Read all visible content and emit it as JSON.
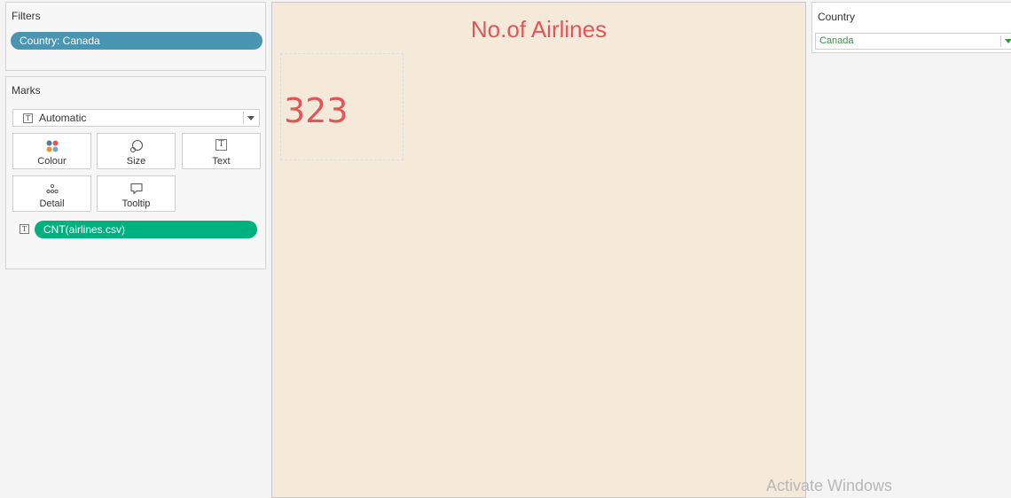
{
  "filters": {
    "title": "Filters",
    "pill": "Country: Canada"
  },
  "marks": {
    "title": "Marks",
    "mark_type": "Automatic",
    "buttons": {
      "colour": "Colour",
      "size": "Size",
      "text": "Text",
      "detail": "Detail",
      "tooltip": "Tooltip"
    },
    "field_pill": "CNT(airlines.csv)"
  },
  "sheet": {
    "title": "No.of Airlines",
    "kpi_value": "323"
  },
  "country_filter": {
    "title": "Country",
    "selected": "Canada"
  },
  "watermark": "Activate Windows",
  "colors": {
    "filter_pill": "#4a95b2",
    "measure_pill": "#00b180",
    "title_red": "#e15759",
    "canvas_bg": "#f5e9da",
    "dropdown_green": "#2e9b3a"
  }
}
